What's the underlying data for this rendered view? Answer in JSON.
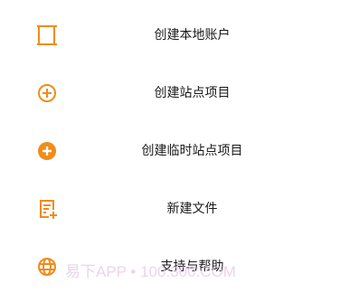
{
  "accent_color": "#F08C1A",
  "menu": {
    "items": [
      {
        "label": "创建本地账户",
        "icon": "local-account-icon"
      },
      {
        "label": "创建站点项目",
        "icon": "plus-circle-outline-icon"
      },
      {
        "label": "创建临时站点项目",
        "icon": "plus-circle-filled-icon"
      },
      {
        "label": "新建文件",
        "icon": "new-file-icon"
      },
      {
        "label": "支持与帮助",
        "icon": "globe-icon"
      }
    ]
  },
  "watermark": {
    "text": "易下APP • 100:300.COM"
  }
}
